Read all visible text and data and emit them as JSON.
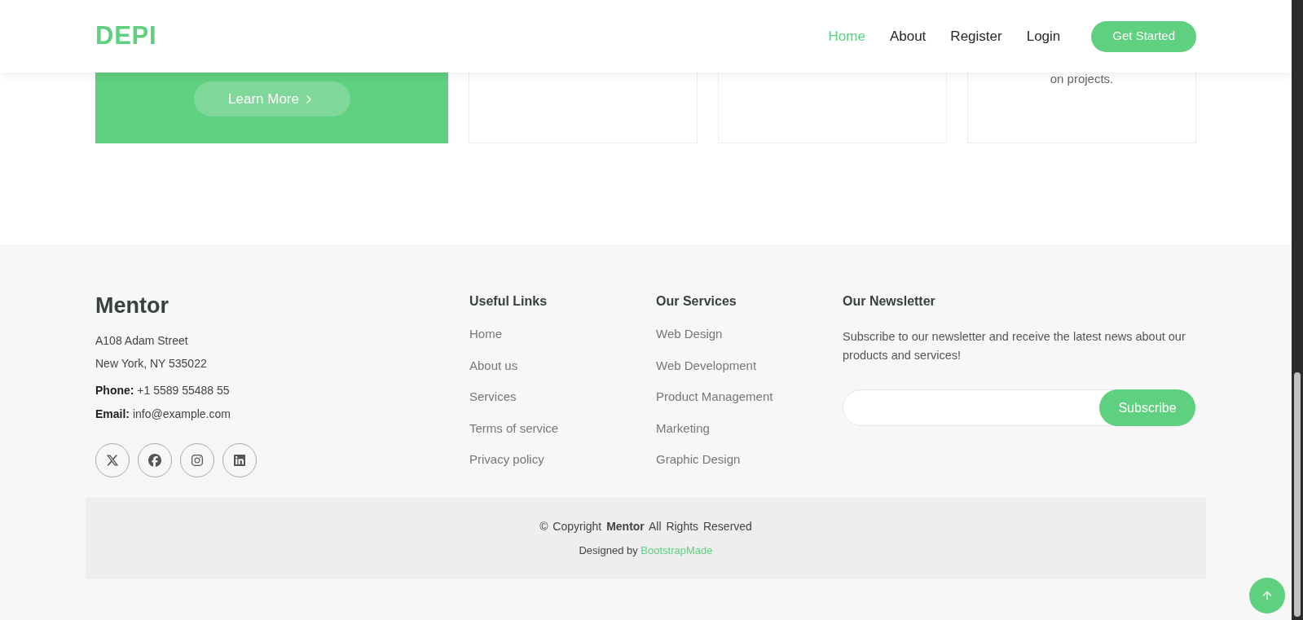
{
  "header": {
    "logo": "DEPI",
    "nav": [
      {
        "label": "Home",
        "selected": true
      },
      {
        "label": "About",
        "selected": false
      },
      {
        "label": "Register",
        "selected": false
      },
      {
        "label": "Login",
        "selected": false
      }
    ],
    "cta": "Get Started"
  },
  "cards": [
    {
      "kind": "feature",
      "button": "Learn More"
    },
    {
      "kind": "plain"
    },
    {
      "kind": "plain"
    },
    {
      "kind": "text",
      "text": "on projects."
    }
  ],
  "footer": {
    "brand": "Mentor",
    "address": [
      "A108 Adam Street",
      "New York, NY 535022"
    ],
    "contacts": [
      {
        "label": "Phone:",
        "value": "+1 5589 55488 55"
      },
      {
        "label": "Email:",
        "value": "info@example.com"
      }
    ],
    "socials": [
      {
        "kind": "x"
      },
      {
        "kind": "facebook"
      },
      {
        "kind": "instagram"
      },
      {
        "kind": "linkedin"
      }
    ],
    "columns": [
      {
        "title": "Useful Links",
        "links": [
          "Home",
          "About us",
          "Services",
          "Terms of service",
          "Privacy policy"
        ]
      },
      {
        "title": "Our Services",
        "links": [
          "Web Design",
          "Web Development",
          "Product Management",
          "Marketing",
          "Graphic Design"
        ]
      }
    ],
    "newsletter": {
      "title": "Our Newsletter",
      "text": "Subscribe to our newsletter and receive the latest news about our products and services!",
      "button": "Subscribe"
    },
    "copyright": "© Copyright **Mentor** All Rights Reserved",
    "designed_by": "Designed by",
    "designer": "BootstrapMade"
  }
}
